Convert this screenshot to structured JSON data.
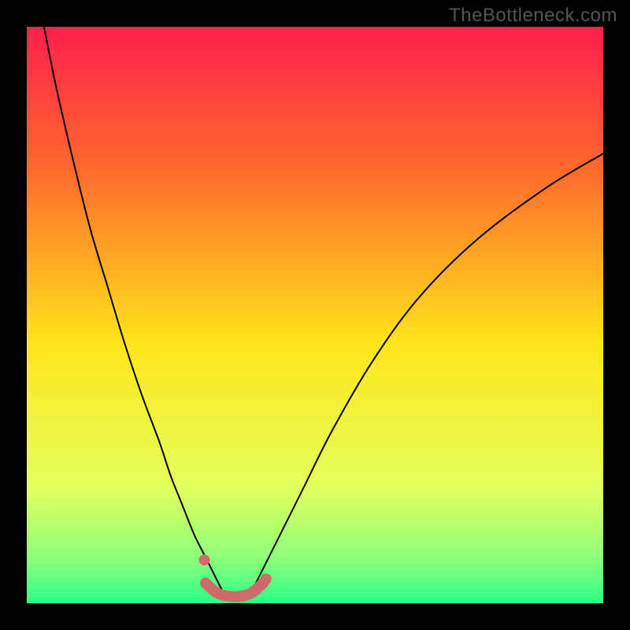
{
  "watermark": "TheBottleneck.com",
  "chart_data": {
    "type": "line",
    "title": "",
    "xlabel": "",
    "ylabel": "",
    "xlim": [
      0,
      100
    ],
    "ylim": [
      0,
      100
    ],
    "background_gradient_stops": [
      {
        "offset": 0,
        "color": "#ff1e4c"
      },
      {
        "offset": 25,
        "color": "#ff6a2c"
      },
      {
        "offset": 55,
        "color": "#ffe51a"
      },
      {
        "offset": 80,
        "color": "#e3ff5c"
      },
      {
        "offset": 92,
        "color": "#8eff7a"
      },
      {
        "offset": 100,
        "color": "#2cff86"
      }
    ],
    "series": [
      {
        "name": "left-branch",
        "x": [
          3,
          5,
          8,
          11,
          14,
          17,
          20,
          23,
          25,
          27,
          29,
          31,
          32.5,
          34
        ],
        "y": [
          100,
          90,
          77,
          65,
          55,
          45,
          36,
          28,
          22,
          17,
          12,
          8,
          5,
          2
        ],
        "stroke": "#000000",
        "width": 2
      },
      {
        "name": "right-branch",
        "x": [
          39,
          41,
          44,
          48,
          53,
          60,
          68,
          78,
          90,
          100
        ],
        "y": [
          2,
          6,
          12,
          20,
          30,
          42,
          53,
          63,
          72,
          78
        ],
        "stroke": "#000000",
        "width": 2
      },
      {
        "name": "flat-bottom",
        "x": [
          31,
          33,
          35,
          37,
          39,
          41
        ],
        "y": [
          3.5,
          1.8,
          1.2,
          1.2,
          1.8,
          3.5
        ],
        "stroke": "#cf6a6a",
        "width": 14
      }
    ],
    "markers": [
      {
        "name": "left-dot",
        "x": 30.8,
        "y": 7.5,
        "r": 7,
        "color": "#cf6a6a"
      },
      {
        "name": "right-dot",
        "x": 41.5,
        "y": 4.2,
        "r": 7,
        "color": "#cf6a6a"
      }
    ]
  }
}
